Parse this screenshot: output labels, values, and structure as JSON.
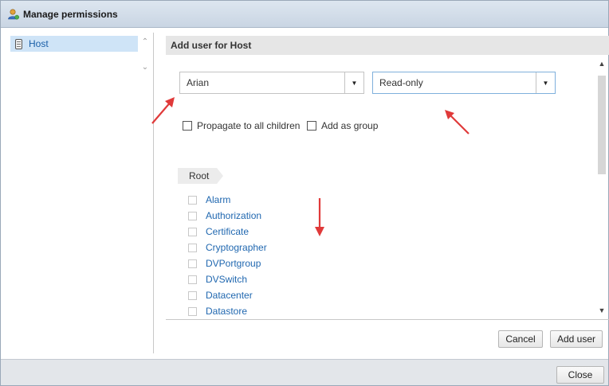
{
  "dialog": {
    "title": "Manage permissions"
  },
  "tree": {
    "items": [
      {
        "label": "Host"
      }
    ]
  },
  "panel": {
    "header": "Add user for Host",
    "user_select": {
      "value": "Arian"
    },
    "role_select": {
      "value": "Read-only"
    },
    "options": {
      "propagate_label": "Propagate to all children",
      "group_label": "Add as group"
    },
    "breadcrumb": [
      "Root"
    ],
    "privileges": [
      "Alarm",
      "Authorization",
      "Certificate",
      "Cryptographer",
      "DVPortgroup",
      "DVSwitch",
      "Datacenter",
      "Datastore"
    ]
  },
  "buttons": {
    "cancel": "Cancel",
    "add_user": "Add user",
    "close": "Close"
  },
  "colors": {
    "accent": "#1a5fa8",
    "link": "#2168b0",
    "annotation_arrow": "#e03a3a"
  }
}
